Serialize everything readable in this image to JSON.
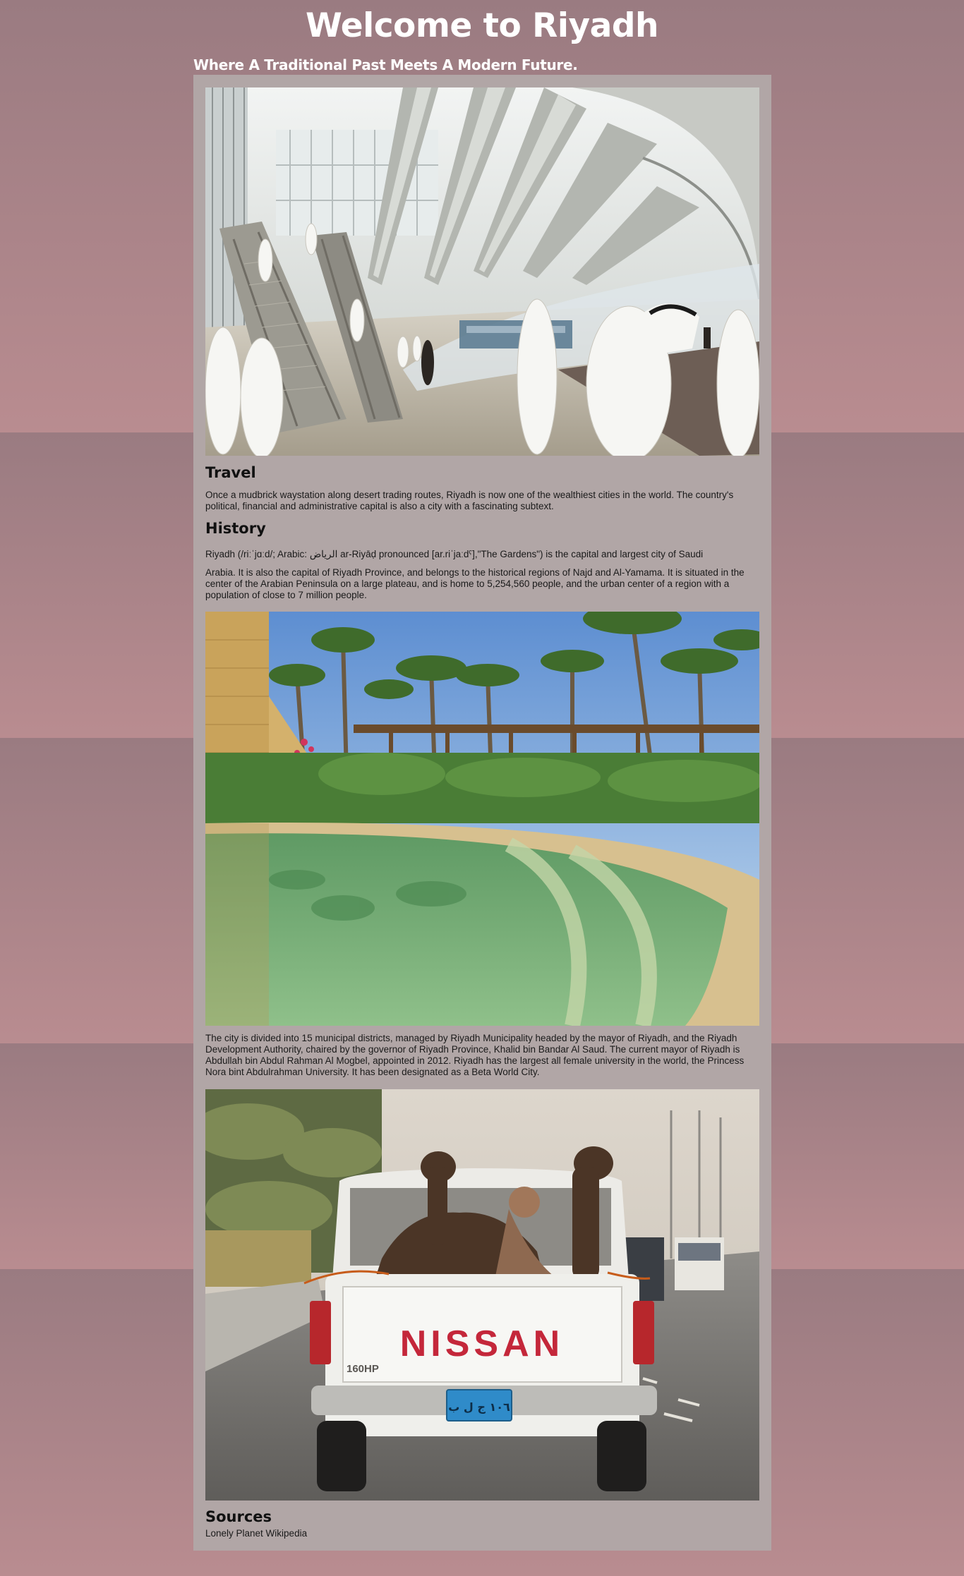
{
  "header": {
    "title": "Welcome to Riyadh",
    "subtitle": "Where A Traditional Past Meets A Modern Future."
  },
  "sections": {
    "travel": {
      "heading": "Travel",
      "text": "Once a mudbrick waystation along desert trading routes, Riyadh is now one of the wealthiest cities in the world. The country's political, financial and administrative capital is also a city with a fascinating subtext."
    },
    "history": {
      "heading": "History",
      "text_line1": "Riyadh (/riːˈjɑːd/; Arabic: الرياض ar-Riyāḍ pronounced [ar.riˈjaːdˤ],\"The Gardens\") is the capital and largest city of Saudi",
      "text_rest": "Arabia. It is also the capital of Riyadh Province, and belongs to the historical regions of Najd and Al-Yamama. It is situated in the center of the Arabian Peninsula on a large plateau, and is home to 5,254,560 people, and the urban center of a region with a population of close to 7 million people."
    },
    "city": {
      "text": "The city is divided into 15 municipal districts, managed by Riyadh Municipality headed by the mayor of Riyadh, and the Riyadh Development Authority, chaired by the governor of Riyadh Province, Khalid bin Bandar Al Saud. The current mayor of Riyadh is Abdullah bin Abdul Rahman Al Mogbel, appointed in 2012. Riyadh has the largest all female university in the world, the Princess Nora bint Abdulrahman University. It has been designated as a Beta World City."
    },
    "sources": {
      "heading": "Sources",
      "text": "Lonely Planet Wikipedia"
    }
  },
  "images": {
    "truck_brand": "NISSAN",
    "truck_badge": "160HP",
    "plate_text": "١٠٦ ج ل ب"
  },
  "colors": {
    "background": "#9b7e84",
    "panel": "#b1a6a6",
    "title_text": "#ffffff",
    "body_text": "#1a1a1a"
  }
}
